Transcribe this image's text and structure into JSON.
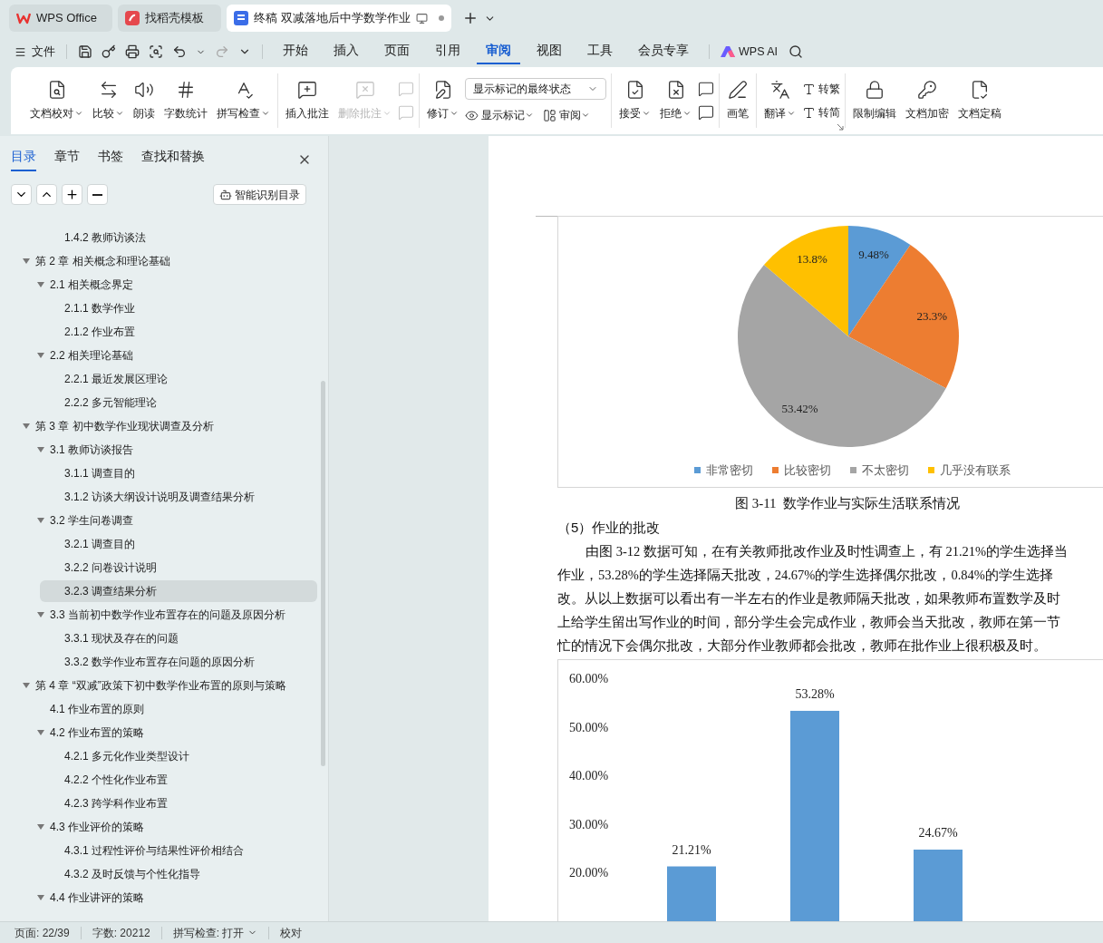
{
  "tab_bar": {
    "tabs": [
      {
        "label": "WPS Office",
        "selected": false,
        "kind": "home"
      },
      {
        "label": "找稻壳模板",
        "selected": false,
        "kind": "template"
      },
      {
        "label": "终稿 双减落地后中学数学作业",
        "selected": true,
        "kind": "document"
      }
    ]
  },
  "menu_bar": {
    "file_menu": "文件",
    "tabs": [
      {
        "label": "开始",
        "selected": false
      },
      {
        "label": "插入",
        "selected": false
      },
      {
        "label": "页面",
        "selected": false
      },
      {
        "label": "引用",
        "selected": false
      },
      {
        "label": "审阅",
        "selected": true
      },
      {
        "label": "视图",
        "selected": false
      },
      {
        "label": "工具",
        "selected": false
      },
      {
        "label": "会员专享",
        "selected": false
      }
    ],
    "ai": "WPS AI"
  },
  "ribbon": {
    "groups": [
      {
        "items": [
          {
            "kind": "large",
            "label": "文档校对",
            "dropdown": true,
            "disabled": false
          },
          {
            "kind": "large",
            "label": "比较",
            "dropdown": true,
            "disabled": false
          },
          {
            "kind": "large",
            "label": "朗读",
            "dropdown": false,
            "disabled": false
          },
          {
            "kind": "large",
            "label": "字数统计",
            "dropdown": false,
            "disabled": false
          },
          {
            "kind": "large",
            "label": "拼写检查",
            "dropdown": true,
            "disabled": false
          }
        ]
      },
      {
        "items": [
          {
            "kind": "large",
            "label": "插入批注",
            "dropdown": false,
            "disabled": false
          },
          {
            "kind": "large",
            "label": "删除批注",
            "dropdown": true,
            "disabled": true
          },
          {
            "kind": "stack",
            "rows": [
              [
                {
                  "kind": "icon",
                  "disabled": true
                }
              ],
              [
                {
                  "kind": "icon",
                  "disabled": true
                }
              ]
            ]
          }
        ]
      },
      {
        "items": [
          {
            "kind": "large",
            "label": "修订",
            "dropdown": true,
            "disabled": false
          },
          {
            "kind": "stack",
            "rows": [
              [
                {
                  "kind": "select",
                  "value": "显示标记的最终状态"
                }
              ],
              [
                {
                  "kind": "small",
                  "label": "显示标记",
                  "dropdown": true,
                  "disabled": false
                },
                {
                  "kind": "small",
                  "label": "审阅",
                  "dropdown": true,
                  "disabled": false
                }
              ]
            ]
          }
        ]
      },
      {
        "items": [
          {
            "kind": "large",
            "label": "接受",
            "dropdown": true,
            "disabled": false
          },
          {
            "kind": "large",
            "label": "拒绝",
            "dropdown": true,
            "disabled": false
          },
          {
            "kind": "stack",
            "rows": [
              [
                {
                  "kind": "icon",
                  "disabled": false
                }
              ],
              [
                {
                  "kind": "icon",
                  "disabled": false
                }
              ]
            ]
          }
        ]
      },
      {
        "items": [
          {
            "kind": "large",
            "label": "画笔",
            "dropdown": false,
            "disabled": false
          }
        ]
      },
      {
        "items": [
          {
            "kind": "large",
            "label": "翻译",
            "dropdown": true,
            "disabled": false
          },
          {
            "kind": "stack",
            "rows": [
              [
                {
                  "kind": "small",
                  "label": "转繁",
                  "dropdown": false,
                  "disabled": false
                }
              ],
              [
                {
                  "kind": "small",
                  "label": "转简",
                  "dropdown": false,
                  "disabled": false
                }
              ]
            ]
          }
        ]
      },
      {
        "items": [
          {
            "kind": "large",
            "label": "限制编辑",
            "dropdown": false,
            "disabled": false
          },
          {
            "kind": "large",
            "label": "文档加密",
            "dropdown": false,
            "disabled": false
          },
          {
            "kind": "large",
            "label": "文档定稿",
            "dropdown": false,
            "disabled": false
          }
        ]
      }
    ]
  },
  "sidebar": {
    "tabs": [
      {
        "label": "目录",
        "selected": true
      },
      {
        "label": "章节",
        "selected": false
      },
      {
        "label": "书签",
        "selected": false
      },
      {
        "label": "查找和替换",
        "selected": false
      }
    ],
    "smart_button": "智能识别目录",
    "toc_continued": [
      {
        "label": "1.4.2 教师访谈法",
        "selected": false
      }
    ],
    "toc": [
      {
        "label": "第 2 章 相关概念和理论基础",
        "expanded": true,
        "selected": false,
        "children": [
          {
            "label": "2.1 相关概念界定",
            "expanded": true,
            "selected": false,
            "children": [
              {
                "label": "2.1.1 数学作业",
                "selected": false
              },
              {
                "label": "2.1.2 作业布置",
                "selected": false
              }
            ]
          },
          {
            "label": "2.2 相关理论基础",
            "expanded": true,
            "selected": false,
            "children": [
              {
                "label": "2.2.1 最近发展区理论",
                "selected": false
              },
              {
                "label": "2.2.2 多元智能理论",
                "selected": false
              }
            ]
          }
        ]
      },
      {
        "label": "第 3 章 初中数学作业现状调查及分析",
        "expanded": true,
        "selected": false,
        "children": [
          {
            "label": "3.1 教师访谈报告",
            "expanded": true,
            "selected": false,
            "children": [
              {
                "label": "3.1.1 调查目的",
                "selected": false
              },
              {
                "label": "3.1.2 访谈大纲设计说明及调查结果分析",
                "selected": false
              }
            ]
          },
          {
            "label": "3.2 学生问卷调查",
            "expanded": true,
            "selected": false,
            "children": [
              {
                "label": "3.2.1 调查目的",
                "selected": false
              },
              {
                "label": "3.2.2 问卷设计说明",
                "selected": false
              },
              {
                "label": "3.2.3 调查结果分析",
                "selected": true
              }
            ]
          },
          {
            "label": "3.3 当前初中数学作业布置存在的问题及原因分析",
            "expanded": true,
            "selected": false,
            "children": [
              {
                "label": "3.3.1 现状及存在的问题",
                "selected": false
              },
              {
                "label": "3.3.2 数学作业布置存在问题的原因分析",
                "selected": false
              }
            ]
          }
        ]
      },
      {
        "label": "第 4 章 “双减”政策下初中数学作业布置的原则与策略",
        "expanded": true,
        "selected": false,
        "children": [
          {
            "label": "4.1 作业布置的原则",
            "selected": false
          },
          {
            "label": "4.2 作业布置的策略",
            "expanded": true,
            "selected": false,
            "children": [
              {
                "label": "4.2.1 多元化作业类型设计",
                "selected": false
              },
              {
                "label": "4.2.2 个性化作业布置",
                "selected": false
              },
              {
                "label": "4.2.3 跨学科作业布置",
                "selected": false
              }
            ]
          },
          {
            "label": "4.3 作业评价的策略",
            "expanded": true,
            "selected": false,
            "children": [
              {
                "label": "4.3.1 过程性评价与结果性评价相结合",
                "selected": false
              },
              {
                "label": "4.3.2 及时反馈与个性化指导",
                "selected": false
              }
            ]
          },
          {
            "label": "4.4 作业讲评的策略",
            "expanded": true,
            "selected": false
          }
        ]
      }
    ]
  },
  "document": {
    "pie_chart": {
      "chart_data": {
        "type": "pie",
        "categories": [
          "非常密切",
          "比较密切",
          "不太密切",
          "几乎没有联系"
        ],
        "colors": [
          "#5b9bd5",
          "#ed7d31",
          "#a5a5a5",
          "#ffc000"
        ],
        "series": [
          {
            "values": [
              9.48,
              23.3,
              53.42,
              13.8
            ]
          }
        ],
        "value_labels": [
          "9.48%",
          "23.3%",
          "53.42%",
          "13.8%"
        ],
        "legend": "bottom"
      }
    },
    "caption": "图 3-11  数学作业与实际生活联系情况",
    "heading": "（5）作业的批改",
    "paragraph_lines": [
      "由图 3-12 数据可知，在有关教师批改作业及时性调查上，有 21.21%的学生选择当",
      "作业，53.28%的学生选择隔天批改，24.67%的学生选择偶尔批改，0.84%的学生选择",
      "改。从以上数据可以看出有一半左右的作业是教师隔天批改，如果教师布置数学及时",
      "上给学生留出写作业的时间，部分学生会完成作业，教师会当天批改，教师在第一节",
      "忙的情况下会偶尔批改，大部分作业教师都会批改，教师在批作业上很积极及时。"
    ],
    "bar_chart": {
      "chart_data": {
        "type": "bar",
        "ylim": [
          0,
          60
        ],
        "yticks": [
          {
            "value": 20,
            "label": "20.00%"
          },
          {
            "value": 30,
            "label": "30.00%"
          },
          {
            "value": 40,
            "label": "40.00%"
          },
          {
            "value": 50,
            "label": "50.00%"
          },
          {
            "value": 60,
            "label": "60.00%"
          }
        ],
        "series": [
          {
            "color": "#5b9bd5",
            "values": [
              21.21,
              53.28,
              24.67
            ]
          }
        ],
        "value_labels": [
          "21.21%",
          "53.28%",
          "24.67%"
        ]
      }
    }
  },
  "status_bar": {
    "page": "页面: 22/39",
    "words": "字数: 20212",
    "spell_check": "拼写检查: 打开",
    "proofread": "校对"
  }
}
